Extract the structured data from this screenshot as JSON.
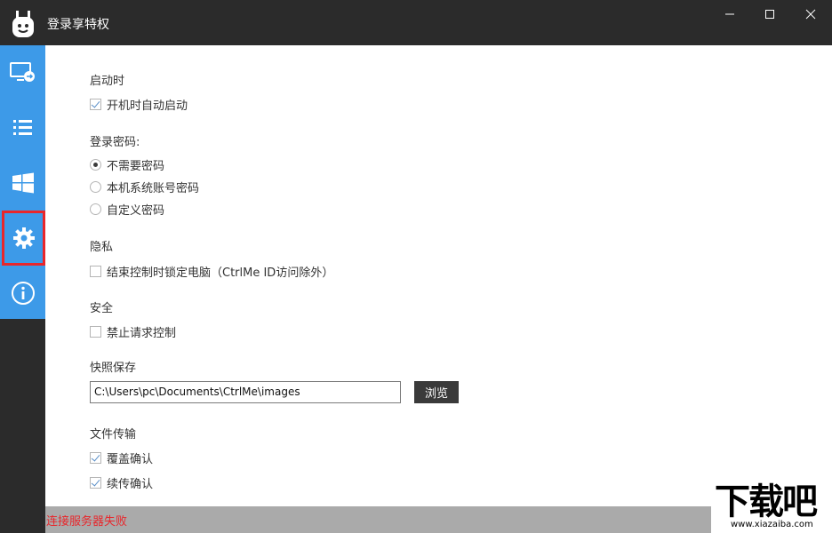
{
  "window": {
    "title": "登录享特权"
  },
  "sidebar": {
    "items": [
      {
        "icon": "remote-desktop-icon"
      },
      {
        "icon": "list-icon"
      },
      {
        "icon": "windows-icon"
      },
      {
        "icon": "gear-icon",
        "selected": true
      },
      {
        "icon": "info-icon"
      }
    ]
  },
  "settings": {
    "startup": {
      "title": "启动时",
      "auto_start_label": "开机时自动启动",
      "auto_start_checked": true
    },
    "login_password": {
      "title": "登录密码:",
      "options": [
        "不需要密码",
        "本机系统账号密码",
        "自定义密码"
      ],
      "selected_index": 0
    },
    "privacy": {
      "title": "隐私",
      "lock_label": "结束控制时锁定电脑（CtrlMe ID访问除外）",
      "lock_checked": false
    },
    "security": {
      "title": "安全",
      "forbid_label": "禁止请求控制",
      "forbid_checked": false
    },
    "snapshot": {
      "title": "快照保存",
      "path_value": "C:\\Users\\pc\\Documents\\CtrlMe\\images",
      "browse_label": "浏览"
    },
    "file_transfer": {
      "title": "文件传输",
      "overwrite_label": "覆盖确认",
      "overwrite_checked": true,
      "resume_label": "续传确认",
      "resume_checked": true
    }
  },
  "status": {
    "message": "连接服务器失败"
  },
  "watermark": {
    "main": "下载吧",
    "sub": "www.xiazaiba.com"
  },
  "colors": {
    "titlebar": "#2b2b2b",
    "sidebar_accent": "#3d9ae8",
    "selection_border": "#e8262b",
    "status_error": "#e8262b",
    "status_bar": "#aaaaaa"
  }
}
